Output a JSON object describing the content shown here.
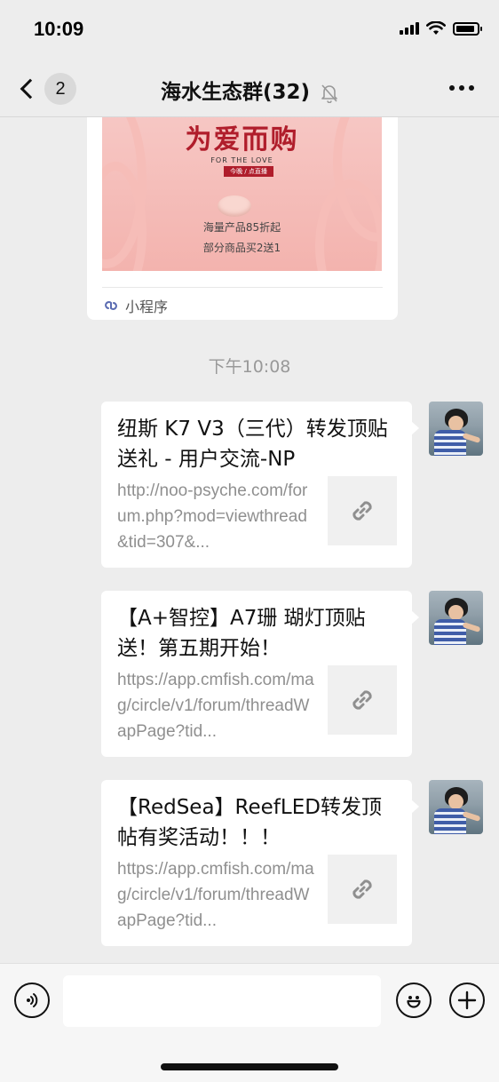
{
  "status_bar": {
    "time": "10:09"
  },
  "nav": {
    "unread_count": "2",
    "title": "海水生态群(32)"
  },
  "mini_program": {
    "banner_title": "为爱而购",
    "banner_subtitle": "FOR THE LOVE",
    "banner_tag": "今晚 / 点直播",
    "banner_line1": "海量产品85折起",
    "banner_line2": "部分商品买2送1",
    "footer_label": "小程序"
  },
  "timestamp": "下午10:08",
  "messages": [
    {
      "title": "纽斯 K7 V3（三代）转发顶贴送礼 - 用户交流-NP",
      "url": "http://noo-psyche.com/forum.php?mod=viewthread&tid=307&..."
    },
    {
      "title": "【A+智控】A7珊 瑚灯顶贴送！第五期开始！",
      "url": "https://app.cmfish.com/mag/circle/v1/forum/threadWapPage?tid..."
    },
    {
      "title": "【RedSea】ReefLED转发顶帖有奖活动！！！",
      "url": "https://app.cmfish.com/mag/circle/v1/forum/threadWapPage?tid..."
    }
  ],
  "input": {
    "value": "",
    "placeholder": ""
  },
  "icons": {
    "back": "chevron-left-icon",
    "mute": "bell-muted-icon",
    "more": "more-dots-icon",
    "mini_program": "mini-program-link-icon",
    "link": "link-icon",
    "voice": "voice-icon",
    "emoji": "emoji-icon",
    "plus": "plus-icon"
  }
}
